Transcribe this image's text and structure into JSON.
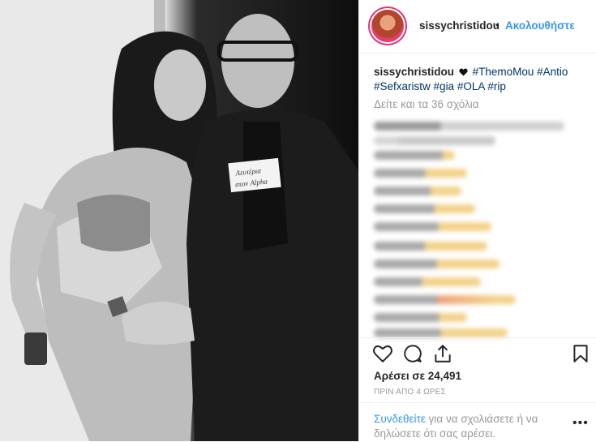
{
  "post": {
    "photo_sign_text": "Λευτέρια στον Alpha"
  },
  "header": {
    "username": "sissychristidou",
    "separator": "•",
    "follow_label": "Ακολουθήστε"
  },
  "caption": {
    "username": "sissychristidou",
    "hashtags": [
      "#ThemoMou",
      "#Antio",
      "#Sefxaristw",
      "#gia",
      "#OLA",
      "#rip"
    ]
  },
  "comments": {
    "view_all_label": "Δείτε και τα 36 σχόλια"
  },
  "actions": {
    "icons": [
      "heart-icon",
      "comment-icon",
      "share-icon",
      "bookmark-icon"
    ]
  },
  "likes": {
    "text": "Αρέσει σε 24,491"
  },
  "timestamp": {
    "text": "ΠΡΙΝ ΑΠΟ 4 ΩΡΕΣ"
  },
  "footer": {
    "login_link": "Συνδεθείτε",
    "login_text": " για να σχολιάσετε ή να δηλώσετε ότι σας αρέσει.",
    "more_label": "•••"
  },
  "colors": {
    "link_blue": "#3897f0",
    "hashtag_blue": "#003569",
    "muted_gray": "#999999"
  }
}
